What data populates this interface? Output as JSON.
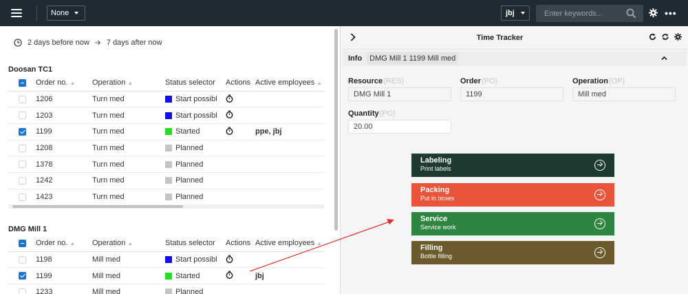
{
  "topbar": {
    "filter_value": "None",
    "user": "jbj",
    "search_placeholder": "Enter keywords..."
  },
  "daterange": {
    "from": "2 days before now",
    "to": "7 days after now"
  },
  "grid_headers": {
    "order": "Order no.",
    "operation": "Operation",
    "status": "Status selector",
    "actions": "Actions",
    "employees": "Active employees"
  },
  "groups": [
    {
      "title": "Doosan TC1",
      "rows": [
        {
          "order": "1206",
          "operation": "Turn med",
          "status": "Start possibl",
          "status_color": "#1010e0",
          "has_action": true,
          "employees": "",
          "checked": false
        },
        {
          "order": "1203",
          "operation": "Turn med",
          "status": "Start possibl",
          "status_color": "#1010e0",
          "has_action": true,
          "employees": "",
          "checked": false
        },
        {
          "order": "1199",
          "operation": "Turn med",
          "status": "Started",
          "status_color": "#22dd22",
          "has_action": true,
          "employees": "ppe, jbj",
          "checked": true
        },
        {
          "order": "1208",
          "operation": "Turn med",
          "status": "Planned",
          "status_color": "#c4c4c4",
          "has_action": false,
          "employees": "",
          "checked": false
        },
        {
          "order": "1378",
          "operation": "Turn med",
          "status": "Planned",
          "status_color": "#c4c4c4",
          "has_action": false,
          "employees": "",
          "checked": false
        },
        {
          "order": "1242",
          "operation": "Turn med",
          "status": "Planned",
          "status_color": "#c4c4c4",
          "has_action": false,
          "employees": "",
          "checked": false
        },
        {
          "order": "1423",
          "operation": "Turn med",
          "status": "Planned",
          "status_color": "#c4c4c4",
          "has_action": false,
          "employees": "",
          "checked": false
        }
      ]
    },
    {
      "title": "DMG Mill 1",
      "rows": [
        {
          "order": "1198",
          "operation": "Mill med",
          "status": "Start possibl",
          "status_color": "#1010e0",
          "has_action": true,
          "employees": "",
          "checked": false
        },
        {
          "order": "1199",
          "operation": "Mill med",
          "status": "Started",
          "status_color": "#22dd22",
          "has_action": true,
          "employees": "jbj",
          "checked": true
        },
        {
          "order": "1233",
          "operation": "Mill med",
          "status": "Planned",
          "status_color": "#c4c4c4",
          "has_action": false,
          "employees": "",
          "checked": false
        }
      ]
    }
  ],
  "tracker": {
    "title": "Time Tracker",
    "info_label": "Info",
    "info_value": "DMG Mill 1 1199 Mill med",
    "resource_label": "Resource",
    "resource_code": "(RES)",
    "resource_value": "DMG Mill 1",
    "order_label": "Order",
    "order_code": "(PO)",
    "order_value": "1199",
    "operation_label": "Operation",
    "operation_code": "(OP)",
    "operation_value": "Mill med",
    "quantity_label": "Quantity",
    "quantity_code": "(PO)",
    "quantity_value": "20.00"
  },
  "tiles": [
    {
      "title": "Labeling",
      "subtitle": "Print labels",
      "color": "#1f3a33"
    },
    {
      "title": "Packing",
      "subtitle": "Put in boxes",
      "color": "#e8553a"
    },
    {
      "title": "Service",
      "subtitle": "Service work",
      "color": "#2e8540"
    },
    {
      "title": "Filling",
      "subtitle": "Bottle filling",
      "color": "#6b5a2c"
    }
  ],
  "colors": {
    "topbar": "#1f2a33",
    "checkbox": "#1976d2",
    "annotation_arrow": "#e0302a"
  }
}
